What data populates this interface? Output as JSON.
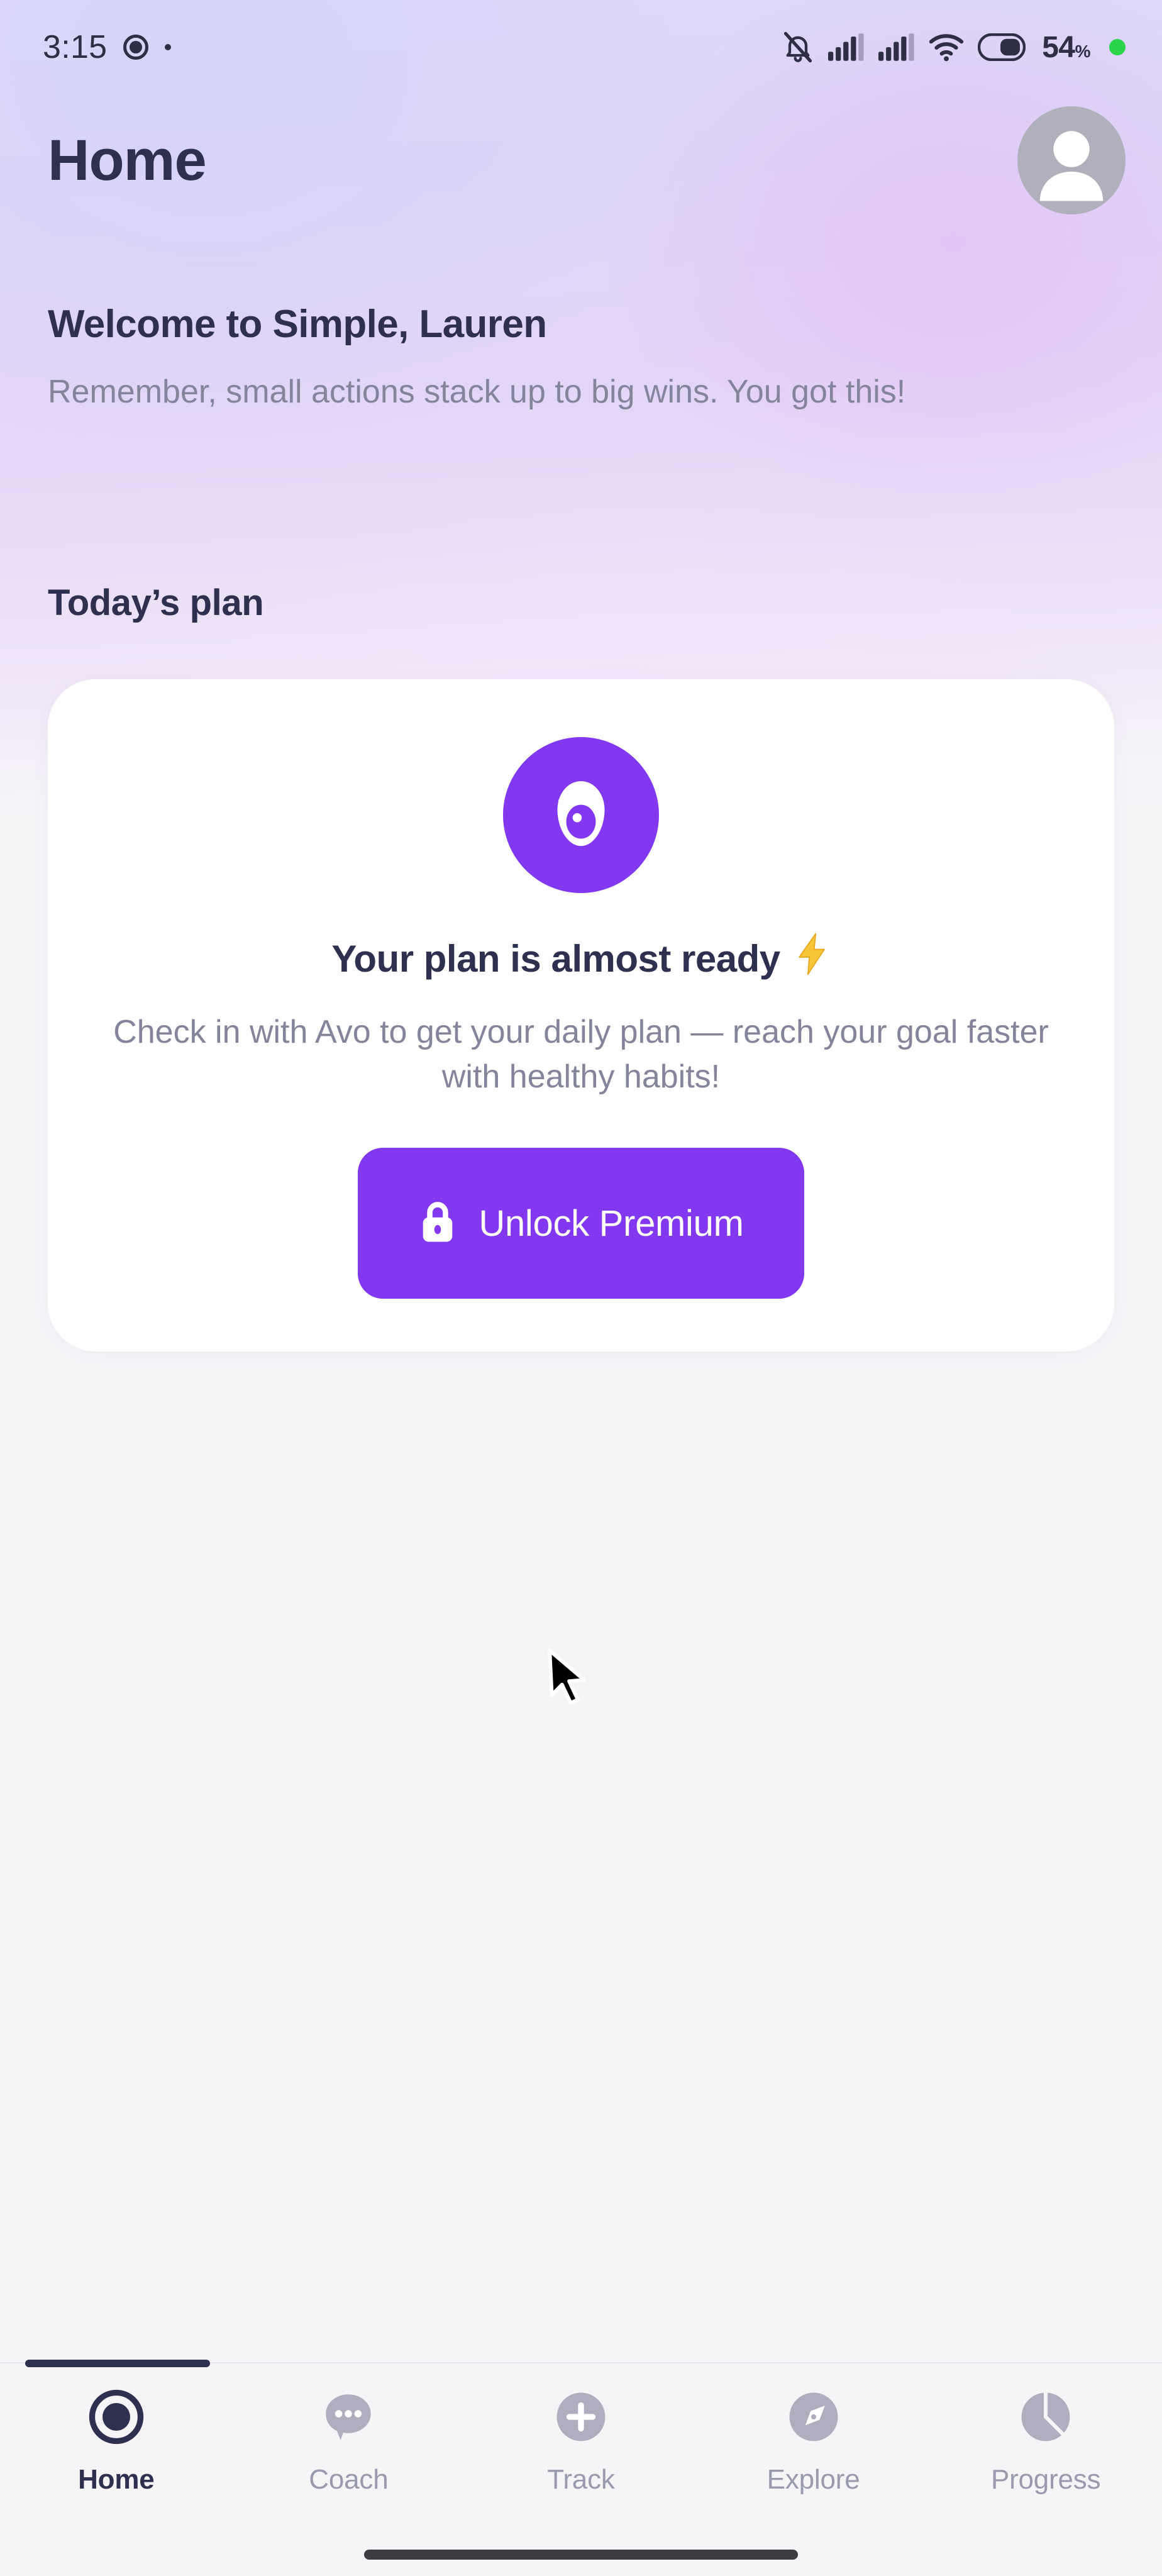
{
  "status_bar": {
    "time": "3:15",
    "icons_left": [
      "record-icon",
      "dot-icon"
    ],
    "icons_right": [
      "silent-bell-icon",
      "signal-bars-icon",
      "signal-bars-icon",
      "wifi-icon",
      "battery-icon"
    ],
    "battery_percent": "54",
    "battery_percent_symbol": "%",
    "indicator_dot_color": "#2bd44a"
  },
  "header": {
    "title": "Home",
    "avatar_alt": "avatar"
  },
  "welcome": {
    "title": "Welcome to Simple, Lauren",
    "subtitle": "Remember, small actions stack up to big wins. You got this!"
  },
  "today": {
    "section_title": "Today’s plan"
  },
  "plan_card": {
    "icon_name": "avocado-icon",
    "headline": "Your plan is almost ready",
    "headline_emoji": "⚡",
    "body": "Check in with Avo to get your daily plan — reach your goal faster with healthy habits!",
    "cta_label": "Unlock Premium",
    "cta_icon": "lock-icon",
    "accent_color": "#8138f0"
  },
  "bottom_nav": {
    "items": [
      {
        "label": "Home",
        "icon": "target-icon",
        "active": true
      },
      {
        "label": "Coach",
        "icon": "chat-bubble-icon",
        "active": false
      },
      {
        "label": "Track",
        "icon": "plus-circle-icon",
        "active": false
      },
      {
        "label": "Explore",
        "icon": "compass-icon",
        "active": false
      },
      {
        "label": "Progress",
        "icon": "pie-chart-icon",
        "active": false
      }
    ]
  },
  "theme": {
    "accent": "#8138f0",
    "text_dark": "#2e3050",
    "text_muted": "#84849a",
    "card_bg": "#ffffff",
    "page_bg": "#f5f5f8"
  }
}
